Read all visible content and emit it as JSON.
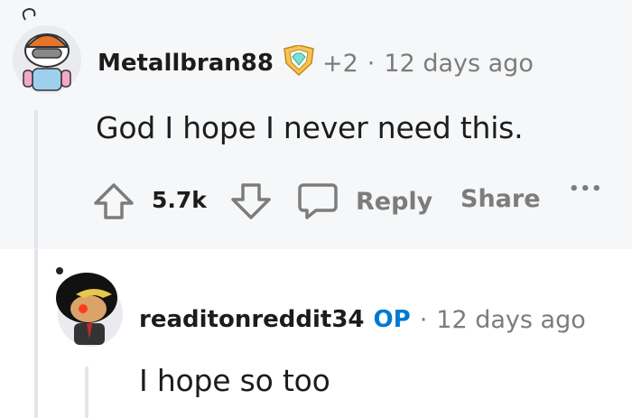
{
  "comments": [
    {
      "username": "Metallbran88",
      "award_count": "+2",
      "separator": "·",
      "time": "12 days ago",
      "body": "God I hope I never need this.",
      "score": "5.7k",
      "actions": {
        "reply": "Reply",
        "share": "Share",
        "more": "•••"
      }
    },
    {
      "username": "readitonreddit34",
      "op_label": "OP",
      "separator": "·",
      "time": "12 days ago",
      "body": "I hope so too"
    }
  ],
  "colors": {
    "op_blue": "#0079d3",
    "meta_grey": "#7c7c7c",
    "thread_line": "#e3e5e8",
    "parent_bg": "#f6f7f8"
  },
  "icons": [
    "upvote-icon",
    "downvote-icon",
    "comment-bubble-icon",
    "award-badge-icon"
  ]
}
